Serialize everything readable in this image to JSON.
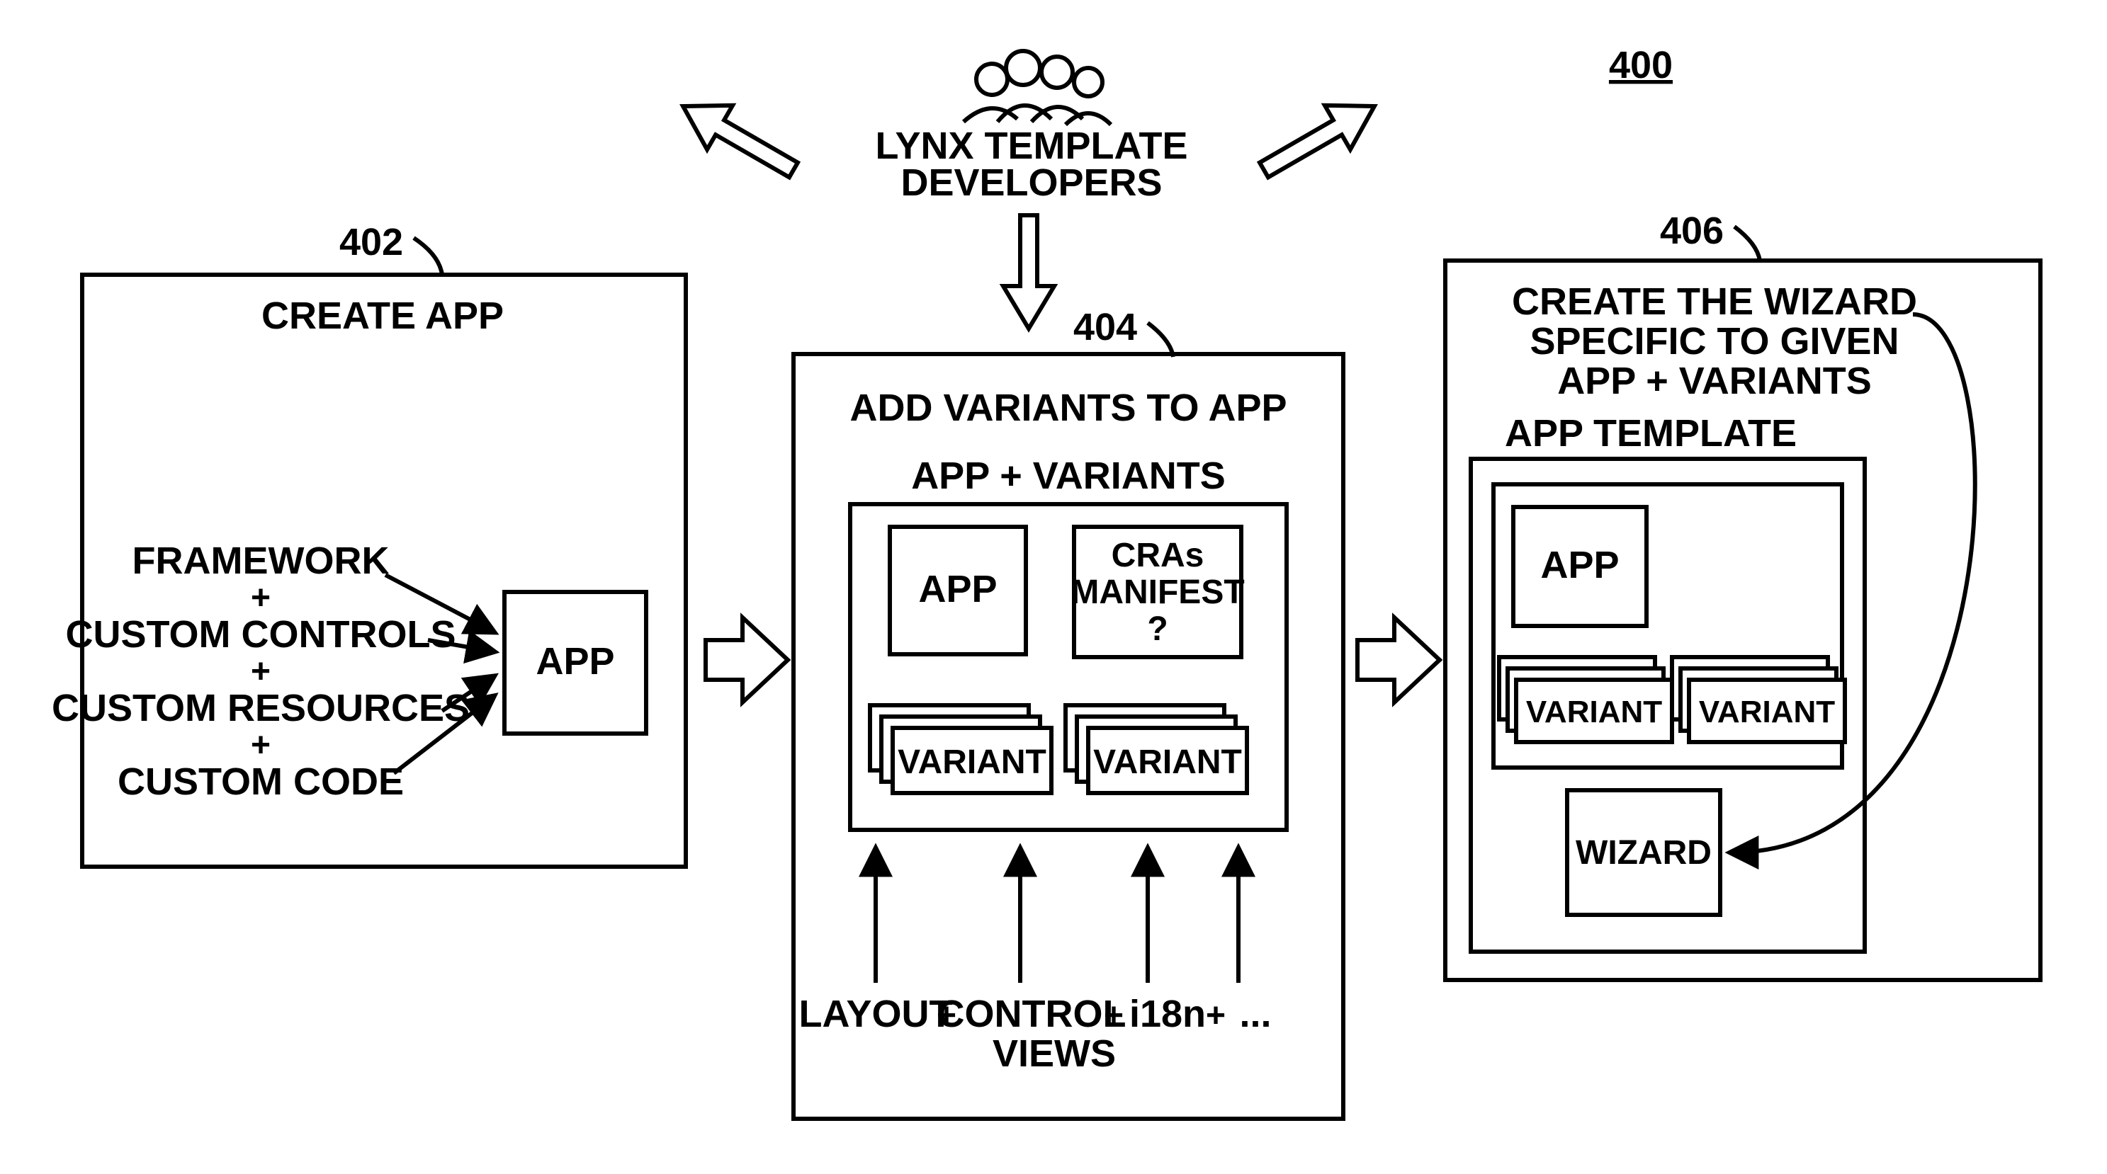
{
  "figure_ref": "400",
  "refs": {
    "box1": "402",
    "box2": "404",
    "box3": "406"
  },
  "devs": {
    "line1": "LYNX TEMPLATE",
    "line2": "DEVELOPERS"
  },
  "box1": {
    "title": "CREATE APP",
    "inputs": {
      "framework": "FRAMEWORK",
      "controls": "CUSTOM CONTROLS",
      "resources": "CUSTOM RESOURCES",
      "code": "CUSTOM CODE",
      "plus": "+"
    },
    "app": "APP"
  },
  "box2": {
    "title": "ADD VARIANTS TO APP",
    "subtitle": "APP + VARIANTS",
    "app": "APP",
    "manifest1": "CRAs",
    "manifest2": "MANIFEST",
    "manifest3": "?",
    "variant": "VARIANT",
    "bottom": {
      "layout": "LAYOUT",
      "control": "CONTROL",
      "i18n": "i18n",
      "dots": "...",
      "views": "VIEWS",
      "plus": "+"
    }
  },
  "box3": {
    "title1": "CREATE THE WIZARD",
    "title2": "SPECIFIC TO GIVEN",
    "title3": "APP + VARIANTS",
    "template_title": "APP TEMPLATE",
    "app": "APP",
    "variant": "VARIANT",
    "wizard": "WIZARD"
  }
}
